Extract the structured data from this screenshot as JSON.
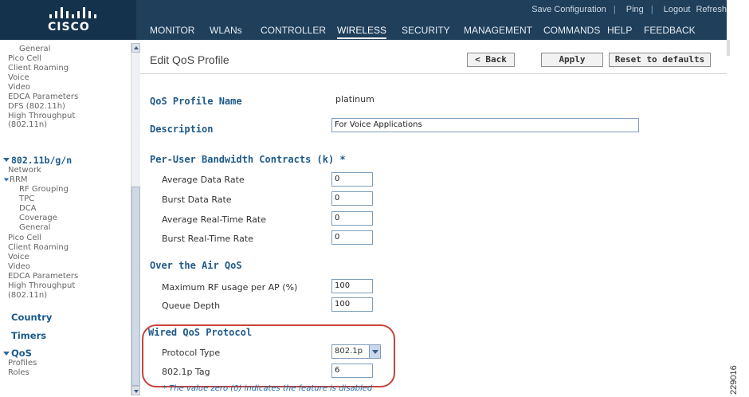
{
  "brand": {
    "logo_text": "cisco"
  },
  "top_links": [
    "Save Configuration",
    "Ping",
    "Logout",
    "Refresh"
  ],
  "nav": [
    "MONITOR",
    "WLANs",
    "CONTROLLER",
    "WIRELESS",
    "SECURITY",
    "MANAGEMENT",
    "COMMANDS",
    "HELP",
    "FEEDBACK"
  ],
  "nav_active": "WIRELESS",
  "sidebar": {
    "group1": [
      "General",
      "Pico Cell",
      "Client Roaming",
      "Voice",
      "Video",
      "EDCA Parameters",
      "DFS (802.11h)",
      "High Throughput",
      "(802.11n)"
    ],
    "section_80211bgn": "802.11b/g/n",
    "network": "Network",
    "rrm": "RRM",
    "rrm_items": [
      "RF Grouping",
      "TPC",
      "DCA",
      "Coverage",
      "General"
    ],
    "group2": [
      "Pico Cell",
      "Client Roaming",
      "Voice",
      "Video",
      "EDCA Parameters",
      "High Throughput",
      "(802.11n)"
    ],
    "country": "Country",
    "timers": "Timers",
    "qos": "QoS",
    "qos_items": [
      "Profiles",
      "Roles"
    ]
  },
  "page": {
    "title": "Edit QoS Profile",
    "back": "< Back",
    "apply": "Apply",
    "reset": "Reset to defaults",
    "profile_name_label": "QoS Profile Name",
    "profile_name_value": "platinum",
    "description_label": "Description",
    "description_value": "For Voice Applications",
    "bandwidth_label": "Per-User Bandwidth Contracts (k)",
    "bandwidth_req": " *",
    "avg_data_rate_label": "Average Data Rate",
    "avg_data_rate": "0",
    "burst_data_rate_label": "Burst Data Rate",
    "burst_data_rate": "0",
    "avg_rt_rate_label": "Average Real-Time Rate",
    "avg_rt_rate": "0",
    "burst_rt_rate_label": "Burst Real-Time Rate",
    "burst_rt_rate": "0",
    "ota_label": "Over the Air QoS",
    "max_rf_label": "Maximum RF usage per AP (%)",
    "max_rf": "100",
    "queue_depth_label": "Queue Depth",
    "queue_depth": "100",
    "wired_label": "Wired QoS Protocol",
    "protocol_type_label": "Protocol Type",
    "protocol_type": "802.1p",
    "tag_label": "802.1p Tag",
    "tag": "6",
    "footnote": "* The value zero (0) indicates the feature is disabled"
  },
  "side_code": "229016",
  "colors": {
    "header": "#1f3f5b",
    "label_blue": "#1f5a8a",
    "highlight": "#c8423d"
  }
}
